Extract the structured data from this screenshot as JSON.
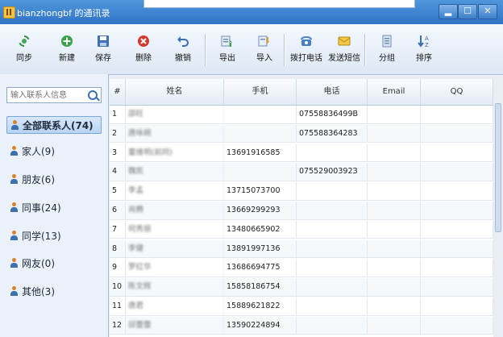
{
  "window": {
    "title": "bianzhongbf 的通讯录",
    "controls": {
      "minimize": "▂",
      "maximize": "☐",
      "close": "✕"
    }
  },
  "toolbar": {
    "sync": "同步",
    "new": "新建",
    "save": "保存",
    "delete": "删除",
    "undo": "撤销",
    "export": "导出",
    "import": "导入",
    "call": "拨打电话",
    "sms": "发送短信",
    "group": "分组",
    "sort": "排序"
  },
  "sidebar": {
    "search_placeholder": "输入联系人信息",
    "groups": [
      {
        "label": "全部联系人(74)"
      },
      {
        "label": "家人(9)"
      },
      {
        "label": "朋友(6)"
      },
      {
        "label": "同事(24)"
      },
      {
        "label": "同学(13)"
      },
      {
        "label": "网友(0)"
      },
      {
        "label": "其他(3)"
      }
    ]
  },
  "table": {
    "columns": [
      "#",
      "姓名",
      "手机",
      "电话",
      "Email",
      "QQ"
    ],
    "rows": [
      {
        "n": "1",
        "name": "邵旺",
        "mobile": "",
        "phone": "07558836499B",
        "email": "",
        "qq": ""
      },
      {
        "n": "2",
        "name": "唐咏婉",
        "mobile": "",
        "phone": "075588364283",
        "email": "",
        "qq": ""
      },
      {
        "n": "3",
        "name": "董维明(前同)",
        "mobile": "13691916585",
        "phone": "",
        "email": "",
        "qq": ""
      },
      {
        "n": "4",
        "name": "魏凯",
        "mobile": "",
        "phone": "07552900392З",
        "email": "",
        "qq": ""
      },
      {
        "n": "5",
        "name": "李孟",
        "mobile": "13715073700",
        "phone": "",
        "email": "",
        "qq": ""
      },
      {
        "n": "6",
        "name": "肖腾",
        "mobile": "13669299293",
        "phone": "",
        "email": "",
        "qq": ""
      },
      {
        "n": "7",
        "name": "何秀丽",
        "mobile": "13480665902",
        "phone": "",
        "email": "",
        "qq": ""
      },
      {
        "n": "8",
        "name": "李健",
        "mobile": "13891997136",
        "phone": "",
        "email": "",
        "qq": ""
      },
      {
        "n": "9",
        "name": "罗红华",
        "mobile": "13686694775",
        "phone": "",
        "email": "",
        "qq": ""
      },
      {
        "n": "10",
        "name": "陈文辉",
        "mobile": "15858186754",
        "phone": "",
        "email": "",
        "qq": ""
      },
      {
        "n": "11",
        "name": "唐君",
        "mobile": "15889621822",
        "phone": "",
        "email": "",
        "qq": ""
      },
      {
        "n": "12",
        "name": "邱蕾蕾",
        "mobile": "13590224894",
        "phone": "",
        "email": "",
        "qq": ""
      }
    ]
  }
}
